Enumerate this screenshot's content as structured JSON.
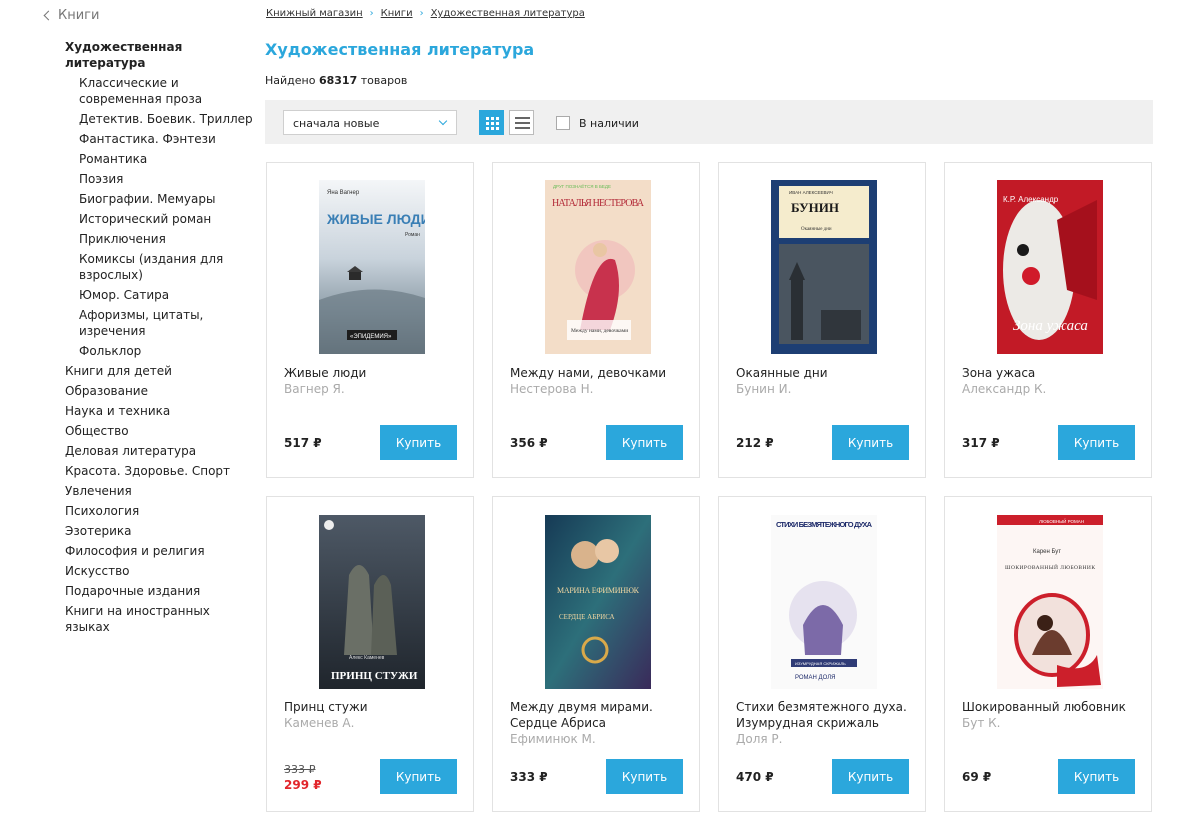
{
  "sidebar": {
    "back": "Книги",
    "categories": [
      {
        "label": "Художественная литература"
      },
      {
        "label": "Классические и современная проза"
      },
      {
        "label": "Детектив. Боевик. Триллер"
      },
      {
        "label": "Фантастика. Фэнтези"
      },
      {
        "label": "Романтика"
      },
      {
        "label": "Поэзия"
      },
      {
        "label": "Биографии. Мемуары"
      },
      {
        "label": "Исторический роман"
      },
      {
        "label": "Приключения"
      },
      {
        "label": "Комиксы (издания для взрослых)"
      },
      {
        "label": "Юмор. Сатира"
      },
      {
        "label": "Афоризмы, цитаты, изречения"
      },
      {
        "label": "Фольклор"
      },
      {
        "label": "Книги для детей"
      },
      {
        "label": "Образование"
      },
      {
        "label": "Наука и техника"
      },
      {
        "label": "Общество"
      },
      {
        "label": "Деловая литература"
      },
      {
        "label": "Красота. Здоровье. Спорт"
      },
      {
        "label": "Увлечения"
      },
      {
        "label": "Психология"
      },
      {
        "label": "Эзотерика"
      },
      {
        "label": "Философия и религия"
      },
      {
        "label": "Искусство"
      },
      {
        "label": "Подарочные издания"
      },
      {
        "label": "Книги на иностранных языках"
      }
    ]
  },
  "breadcrumb": [
    "Книжный магазин",
    "Книги",
    "Художественная литература"
  ],
  "page_title": "Художественная литература",
  "found": {
    "prefix": "Найдено",
    "count": "68317",
    "suffix": "товаров"
  },
  "toolbar": {
    "sort_value": "сначала новые",
    "in_stock_label": "В наличии"
  },
  "buy_label": "Купить",
  "products": [
    {
      "title": "Живые люди",
      "author": "Вагнер Я.",
      "price": "517 ₽"
    },
    {
      "title": "Между нами, девочками",
      "author": "Нестерова Н.",
      "price": "356 ₽"
    },
    {
      "title": "Окаянные дни",
      "author": "Бунин И.",
      "price": "212 ₽"
    },
    {
      "title": "Зона ужаса",
      "author": "Александр К.",
      "price": "317 ₽"
    },
    {
      "title": "Принц стужи",
      "author": "Каменев А.",
      "old_price": "333 ₽",
      "price": "299 ₽"
    },
    {
      "title": "Между двумя мирами. Сердце Абриса",
      "author": "Ефиминюк М.",
      "price": "333 ₽"
    },
    {
      "title": "Стихи безмятежного духа. Изумрудная скрижаль",
      "author": "Доля Р.",
      "price": "470 ₽"
    },
    {
      "title": "Шокированный любовник",
      "author": "Бут К.",
      "price": "69 ₽"
    }
  ],
  "covers": [
    {
      "publisher": "Яна Вагнер",
      "title": "ЖИВЫЕ ЛЮДИ",
      "subtitle": "Роман",
      "tag": "«ЭПИДЕМИЯ»"
    },
    {
      "top": "ДРУГ ПОЗНАЁТСЯ В БЕДЕ",
      "author": "НАТАЛЬЯ НЕСТЕРОВА",
      "title": "Между нами, девочками"
    },
    {
      "author": "ИВАН АЛЕКСЕЕВИЧ",
      "title": "БУНИН",
      "subtitle": "Окаянные дни"
    },
    {
      "author": "К.Р. Александр",
      "title": "Зона ужаса"
    },
    {
      "author": "Алекс Каменев",
      "title": "ПРИНЦ СТУЖИ"
    },
    {
      "author": "МАРИНА ЕФИМИНЮК",
      "title": "СЕРДЦЕ АБРИСА"
    },
    {
      "title": "СТИХИ БЕЗМЯТЕЖНОГО ДУХА",
      "subtitle": "ИЗУМРУДНАЯ СКРИЖАЛЬ",
      "author": "РОМАН ДОЛЯ"
    },
    {
      "top": "ЛЮБОВНЫЙ РОМАН",
      "author": "Карен Бут",
      "title": "ШОКИРОВАННЫЙ ЛЮБОВНИК"
    }
  ],
  "colors": {
    "accent": "#2ba7dc",
    "sale": "#e2252b",
    "toolbar_bg": "#f0f0f0"
  }
}
